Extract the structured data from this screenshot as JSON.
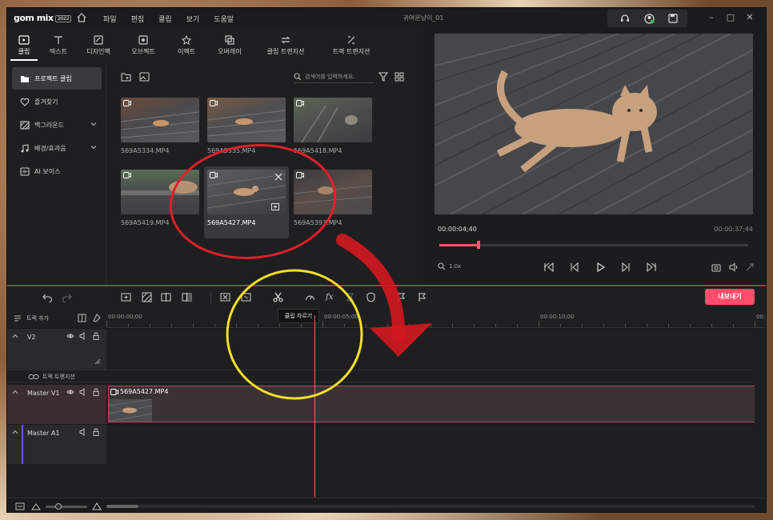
{
  "app": {
    "logo_text": "gom mix",
    "logo_badge": "2022",
    "document_title": "귀여운냥이_01",
    "menu": [
      "파일",
      "편집",
      "클립",
      "보기",
      "도움말"
    ]
  },
  "tabs": [
    {
      "label": "클립",
      "icon": "clip-icon",
      "active": true
    },
    {
      "label": "텍스트",
      "icon": "text-icon"
    },
    {
      "label": "디자인팩",
      "icon": "design-pack-icon"
    },
    {
      "label": "오브젝트",
      "icon": "object-icon"
    },
    {
      "label": "이펙트",
      "icon": "effect-icon"
    },
    {
      "label": "오버레이",
      "icon": "overlay-icon"
    },
    {
      "label": "클립 트랜지션",
      "icon": "clip-transition-icon"
    },
    {
      "label": "트랙 트랜지션",
      "icon": "track-transition-icon"
    }
  ],
  "sidebar": {
    "items": [
      {
        "label": "프로젝트 클립",
        "icon": "folder-icon",
        "active": true
      },
      {
        "label": "즐겨찾기",
        "icon": "heart-icon"
      },
      {
        "label": "백그라운드",
        "icon": "background-icon",
        "expandable": true
      },
      {
        "label": "배경/효과음",
        "icon": "music-icon",
        "expandable": true
      },
      {
        "label": "AI 보이스",
        "icon": "ai-voice-icon"
      }
    ]
  },
  "media": {
    "search_placeholder": "검색어를 입력하세요.",
    "clips": [
      {
        "name": "569A5334.MP4"
      },
      {
        "name": "569A5335.MP4"
      },
      {
        "name": "569A5418.MP4"
      },
      {
        "name": "569A5419.MP4"
      },
      {
        "name": "569A5427.MP4",
        "selected": true
      },
      {
        "name": "569A5393.MP4"
      }
    ]
  },
  "preview": {
    "current_time": "00:00:04;40",
    "total_time": "00:00:37;44",
    "progress": 0.126,
    "zoom_label": "1.0x"
  },
  "timeline": {
    "export_label": "내보내기",
    "tooltip": "클립 자르기",
    "add_track_label": "트랙 추가",
    "ruler_labels": [
      "00:00:00;00",
      "00:00:05;00",
      "00:00:10;00",
      "00:"
    ],
    "tracks": [
      {
        "name": "V2"
      },
      {
        "name": "Master V1"
      },
      {
        "name": "Master A1"
      }
    ],
    "transition_label": "트랙 트랜지션",
    "clip_name": "569A5427.MP4"
  },
  "colors": {
    "accent": "#ff4d6a",
    "background": "#1f1f21",
    "annotation_red": "#e0202a",
    "annotation_yellow": "#f2e12a"
  }
}
